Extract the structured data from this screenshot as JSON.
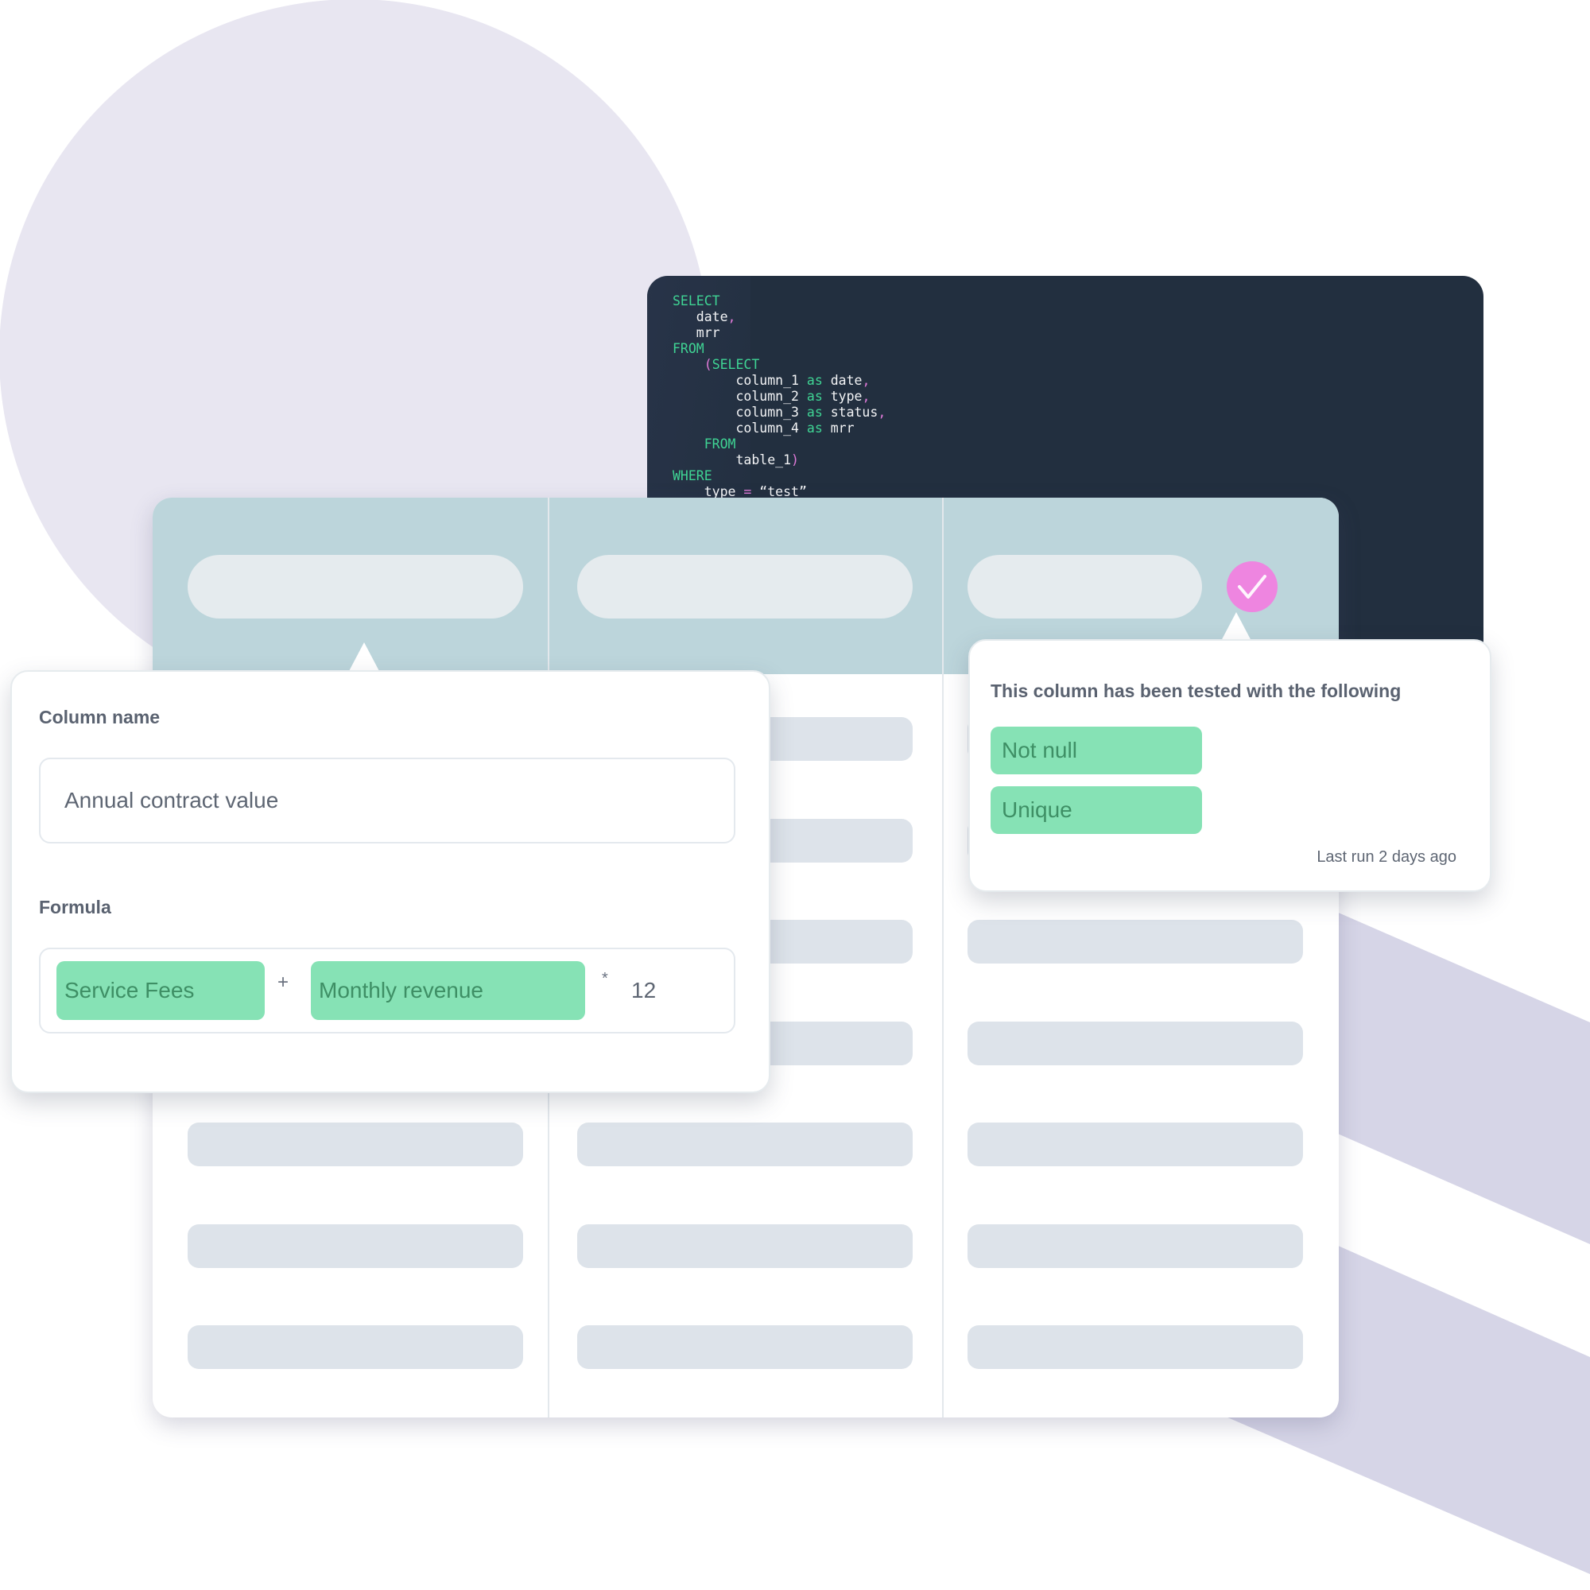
{
  "colors": {
    "background_circle": "#e8e6f1",
    "background_stripe": "#d6d5e7",
    "code_background": "#222f3f",
    "code_keyword": "#3fd494",
    "code_punctuation": "#e07ad9",
    "table_header": "#bcd5db",
    "check_badge": "#ee85e0",
    "chip_green": "#86e2b5"
  },
  "code_editor": {
    "lines": [
      [
        {
          "t": "SELECT",
          "k": "kw"
        }
      ],
      [
        {
          "t": "   date"
        },
        {
          "t": ",",
          "k": "pn"
        }
      ],
      [
        {
          "t": "   mrr"
        }
      ],
      [
        {
          "t": "FROM",
          "k": "kw"
        }
      ],
      [
        {
          "t": "    "
        },
        {
          "t": "(",
          "k": "pn"
        },
        {
          "t": "SELECT",
          "k": "kw"
        }
      ],
      [
        {
          "t": "        column_1 "
        },
        {
          "t": "as",
          "k": "kw"
        },
        {
          "t": " date"
        },
        {
          "t": ",",
          "k": "pn"
        }
      ],
      [
        {
          "t": "        column_2 "
        },
        {
          "t": "as",
          "k": "kw"
        },
        {
          "t": " type"
        },
        {
          "t": ",",
          "k": "pn"
        }
      ],
      [
        {
          "t": "        column_3 "
        },
        {
          "t": "as",
          "k": "kw"
        },
        {
          "t": " status"
        },
        {
          "t": ",",
          "k": "pn"
        }
      ],
      [
        {
          "t": "        column_4 "
        },
        {
          "t": "as",
          "k": "kw"
        },
        {
          "t": " mrr"
        }
      ],
      [
        {
          "t": "    "
        },
        {
          "t": "FROM",
          "k": "kw"
        }
      ],
      [
        {
          "t": "        table_1"
        },
        {
          "t": ")",
          "k": "pn"
        }
      ],
      [
        {
          "t": "WHERE",
          "k": "kw"
        }
      ],
      [
        {
          "t": "    type "
        },
        {
          "t": "=",
          "k": "pn"
        },
        {
          "t": " “test”"
        }
      ]
    ]
  },
  "table": {
    "columns": 3,
    "body_rows": 7,
    "header_check_icon": "check-icon"
  },
  "column_editor": {
    "column_name_label": "Column name",
    "column_name_value": "Annual contract value",
    "formula_label": "Formula",
    "formula": {
      "term_1": "Service Fees",
      "operator_1": "+",
      "term_2": "Monthly revenue",
      "operator_2": "*",
      "constant": "12"
    }
  },
  "test_popup": {
    "title": "This column has been tested with the following",
    "tests": [
      "Not null",
      "Unique"
    ],
    "last_run": "Last run 2 days ago"
  }
}
